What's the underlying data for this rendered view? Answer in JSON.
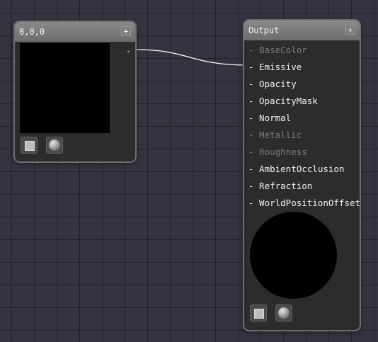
{
  "wire_color": "#ffffff",
  "color_node": {
    "title": "0,0,0",
    "add_label": "+",
    "output_pin": "-",
    "swatch_color": "#000000",
    "buttons": [
      {
        "icon": "square-preview-icon"
      },
      {
        "icon": "sphere-preview-icon"
      }
    ]
  },
  "output_node": {
    "title": "Output",
    "add_label": "+",
    "inputs": [
      {
        "label": "- BaseColor",
        "enabled": false
      },
      {
        "label": "- Emissive",
        "enabled": true
      },
      {
        "label": "- Opacity",
        "enabled": true
      },
      {
        "label": "- OpacityMask",
        "enabled": true
      },
      {
        "label": "- Normal",
        "enabled": true
      },
      {
        "label": "- Metallic",
        "enabled": false
      },
      {
        "label": "- Roughness",
        "enabled": false
      },
      {
        "label": "- AmbientOcclusion",
        "enabled": true
      },
      {
        "label": "- Refraction",
        "enabled": true
      },
      {
        "label": "- WorldPositionOffset",
        "enabled": true
      }
    ],
    "preview_color": "#000000",
    "buttons": [
      {
        "icon": "square-preview-icon"
      },
      {
        "icon": "sphere-preview-icon"
      }
    ]
  }
}
